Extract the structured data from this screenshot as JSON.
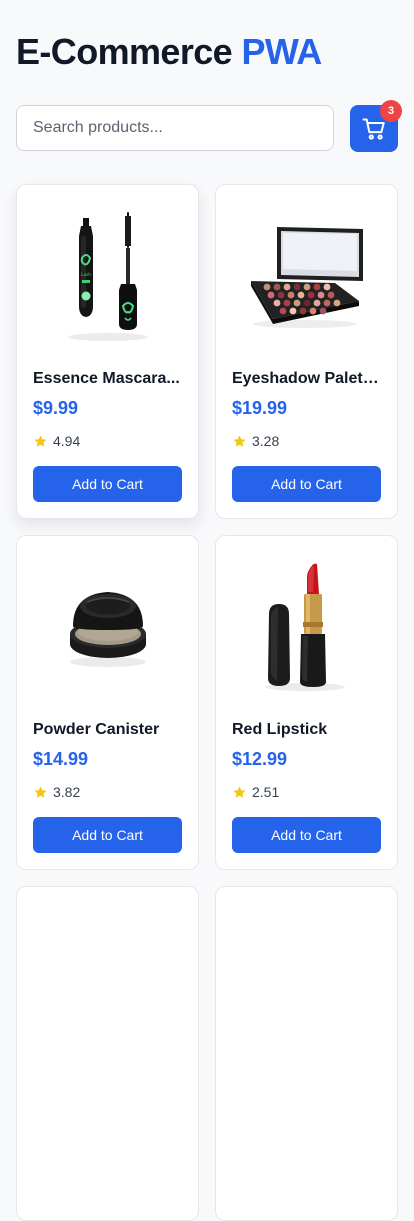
{
  "header": {
    "title_main": "E-Commerce",
    "title_accent": "PWA"
  },
  "search": {
    "placeholder": "Search products...",
    "value": ""
  },
  "cart": {
    "icon": "cart-icon",
    "count": "3"
  },
  "products": [
    {
      "name": "Essence Mascara...",
      "price": "$9.99",
      "rating": "4.94",
      "button_label": "Add to Cart",
      "image": "mascara-image"
    },
    {
      "name": "Eyeshadow Palett...",
      "price": "$19.99",
      "rating": "3.28",
      "button_label": "Add to Cart",
      "image": "eyeshadow-palette-image"
    },
    {
      "name": "Powder Canister",
      "price": "$14.99",
      "rating": "3.82",
      "button_label": "Add to Cart",
      "image": "powder-canister-image"
    },
    {
      "name": "Red Lipstick",
      "price": "$12.99",
      "rating": "2.51",
      "button_label": "Add to Cart",
      "image": "red-lipstick-image"
    }
  ],
  "colors": {
    "accent": "#2563eb",
    "badge": "#ef4444",
    "star": "#f5c518",
    "background": "#f8f9fb"
  }
}
